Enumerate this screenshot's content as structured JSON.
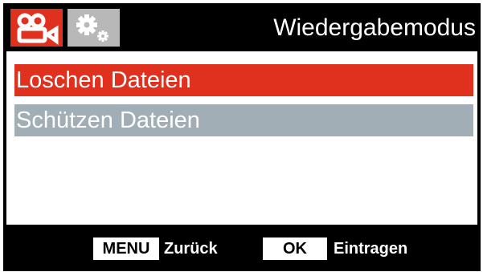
{
  "header": {
    "tabs": [
      {
        "icon": "video-camera-icon",
        "color": "#e0301e",
        "active": true
      },
      {
        "icon": "gears-icon",
        "color": "#b8b8b8",
        "active": false
      }
    ],
    "title": "Wiedergabemodus"
  },
  "menu": {
    "items": [
      {
        "label": "Loschen Dateien",
        "selected": true,
        "color": "#e0301e"
      },
      {
        "label": "Schützen Dateien",
        "selected": false,
        "color": "#a2aeb5"
      }
    ]
  },
  "footer": {
    "menu_key": "MENU",
    "menu_action": "Zurück",
    "ok_key": "OK",
    "ok_action": "Eintragen"
  }
}
